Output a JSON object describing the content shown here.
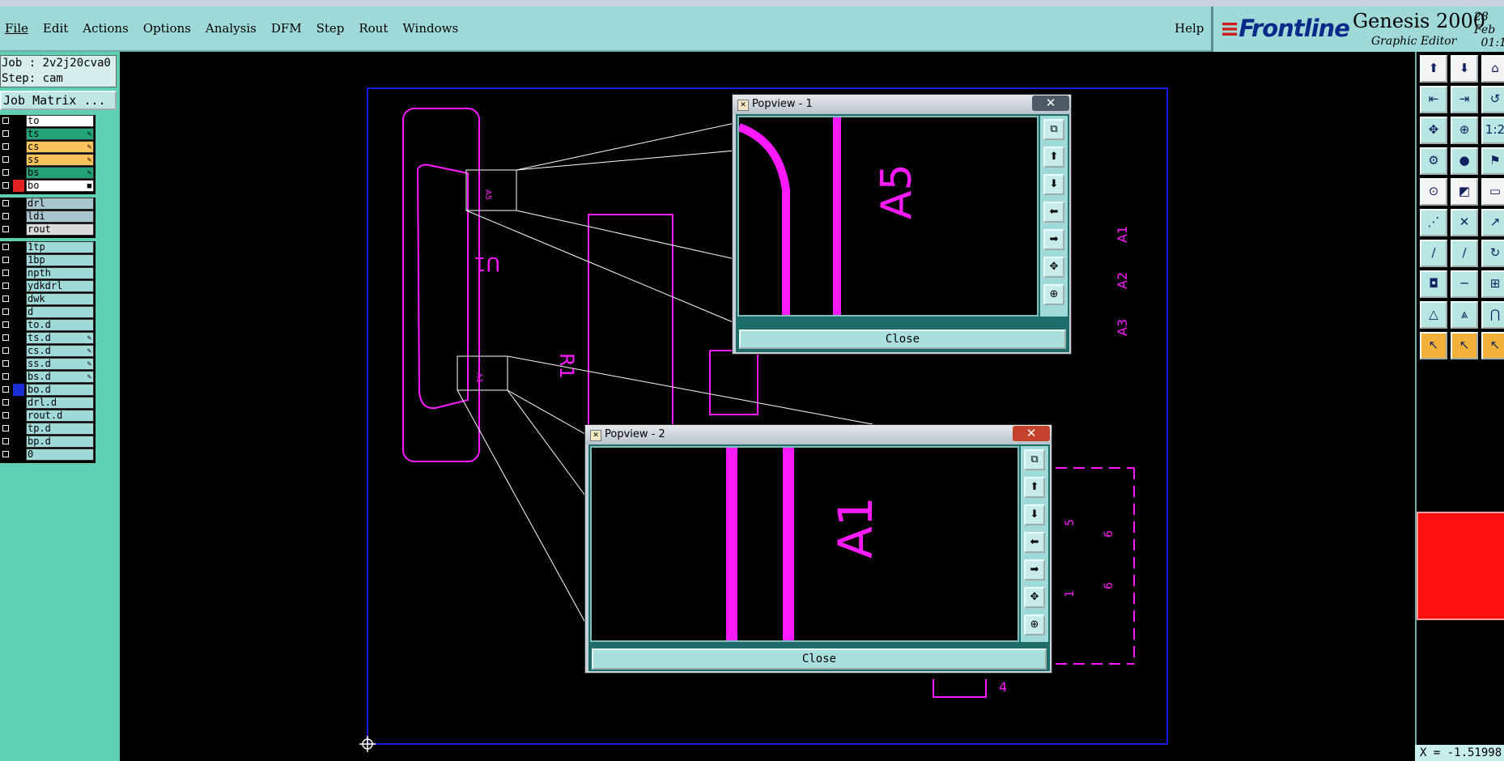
{
  "menubar": {
    "items": [
      "File",
      "Edit",
      "Actions",
      "Options",
      "Analysis",
      "DFM",
      "Step",
      "Rout",
      "Windows"
    ],
    "help": "Help"
  },
  "brand": {
    "logo": "Frontline",
    "product": "Genesis 2000",
    "subtitle": "Graphic Editor",
    "date_line1": "28 Feb",
    "date_line2": "01:1"
  },
  "job": {
    "job_line": "Job : 2v2j20cva0",
    "step_line": "Step: cam",
    "matrix_button": "Job Matrix ..."
  },
  "layers": {
    "group1": [
      {
        "name": "to",
        "color": "#000000",
        "bg": "#ffffff",
        "flag": ""
      },
      {
        "name": "ts",
        "color": "#000000",
        "bg": "#22a37a",
        "flag": "✎"
      },
      {
        "name": "cs",
        "color": "#000000",
        "bg": "#f6c25a",
        "flag": "✎"
      },
      {
        "name": "ss",
        "color": "#000000",
        "bg": "#f6c25a",
        "flag": "✎"
      },
      {
        "name": "bs",
        "color": "#000000",
        "bg": "#22a37a",
        "flag": "✎"
      },
      {
        "name": "bo",
        "color": "#e32222",
        "bg": "#ffffff",
        "flag": "■"
      }
    ],
    "group2": [
      {
        "name": "drl",
        "color": "#000000",
        "bg": "#a8c4cc",
        "flag": ""
      },
      {
        "name": "ldi",
        "color": "#000000",
        "bg": "#a8c4cc",
        "flag": ""
      },
      {
        "name": "rout",
        "color": "#000000",
        "bg": "#d8dcdc",
        "flag": ""
      }
    ],
    "group3": [
      {
        "name": "1tp",
        "color": "#000000",
        "bg": "#9fdad8",
        "flag": ""
      },
      {
        "name": "1bp",
        "color": "#000000",
        "bg": "#9fdad8",
        "flag": ""
      },
      {
        "name": "npth",
        "color": "#000000",
        "bg": "#9fdad8",
        "flag": ""
      },
      {
        "name": "ydkdrl",
        "color": "#000000",
        "bg": "#9fdad8",
        "flag": ""
      },
      {
        "name": "dwk",
        "color": "#000000",
        "bg": "#9fdad8",
        "flag": ""
      },
      {
        "name": "d",
        "color": "#000000",
        "bg": "#9fdad8",
        "flag": ""
      },
      {
        "name": "to.d",
        "color": "#000000",
        "bg": "#9fdad8",
        "flag": ""
      },
      {
        "name": "ts.d",
        "color": "#000000",
        "bg": "#9fdad8",
        "flag": "✎"
      },
      {
        "name": "cs.d",
        "color": "#000000",
        "bg": "#9fdad8",
        "flag": "✎"
      },
      {
        "name": "ss.d",
        "color": "#000000",
        "bg": "#9fdad8",
        "flag": "✎"
      },
      {
        "name": "bs.d",
        "color": "#000000",
        "bg": "#9fdad8",
        "flag": "✎"
      },
      {
        "name": "bo.d",
        "color": "#1a2fd6",
        "bg": "#9fdad8",
        "flag": ""
      },
      {
        "name": "drl.d",
        "color": "#000000",
        "bg": "#9fdad8",
        "flag": ""
      },
      {
        "name": "rout.d",
        "color": "#000000",
        "bg": "#9fdad8",
        "flag": ""
      },
      {
        "name": "tp.d",
        "color": "#000000",
        "bg": "#9fdad8",
        "flag": ""
      },
      {
        "name": "bp.d",
        "color": "#000000",
        "bg": "#9fdad8",
        "flag": ""
      },
      {
        "name": "0",
        "color": "#000000",
        "bg": "#9fdad8",
        "flag": ""
      }
    ]
  },
  "canvas_labels": {
    "u1": "U1",
    "r1": "R1",
    "a5_small": "A5",
    "a1_small": "A1",
    "a_right": [
      "A1",
      "A2",
      "A3"
    ],
    "dim_5": "5",
    "dim_6a": "6",
    "dim_1": "1",
    "dim_6b": "6",
    "dim_4": "4"
  },
  "popview1": {
    "title": "Popview - 1",
    "close_label": "Close",
    "label": "A5",
    "close_x": "✕"
  },
  "popview2": {
    "title": "Popview - 2",
    "close_label": "Close",
    "label": "A1",
    "close_x": "✕"
  },
  "popview_tools": [
    "popview-zoom-window-icon",
    "popview-pan-up-icon",
    "popview-pan-down-icon",
    "popview-pan-left-icon",
    "popview-pan-right-icon",
    "popview-zoom-fit-icon",
    "popview-zoom-home-icon"
  ],
  "coordinate": "X = -1.51998",
  "colors": {
    "magenta": "#ff1aff",
    "profile_blue": "#1a1ae6",
    "panel_teal": "#9fdad8",
    "layer_panel": "#5fcfb3"
  }
}
